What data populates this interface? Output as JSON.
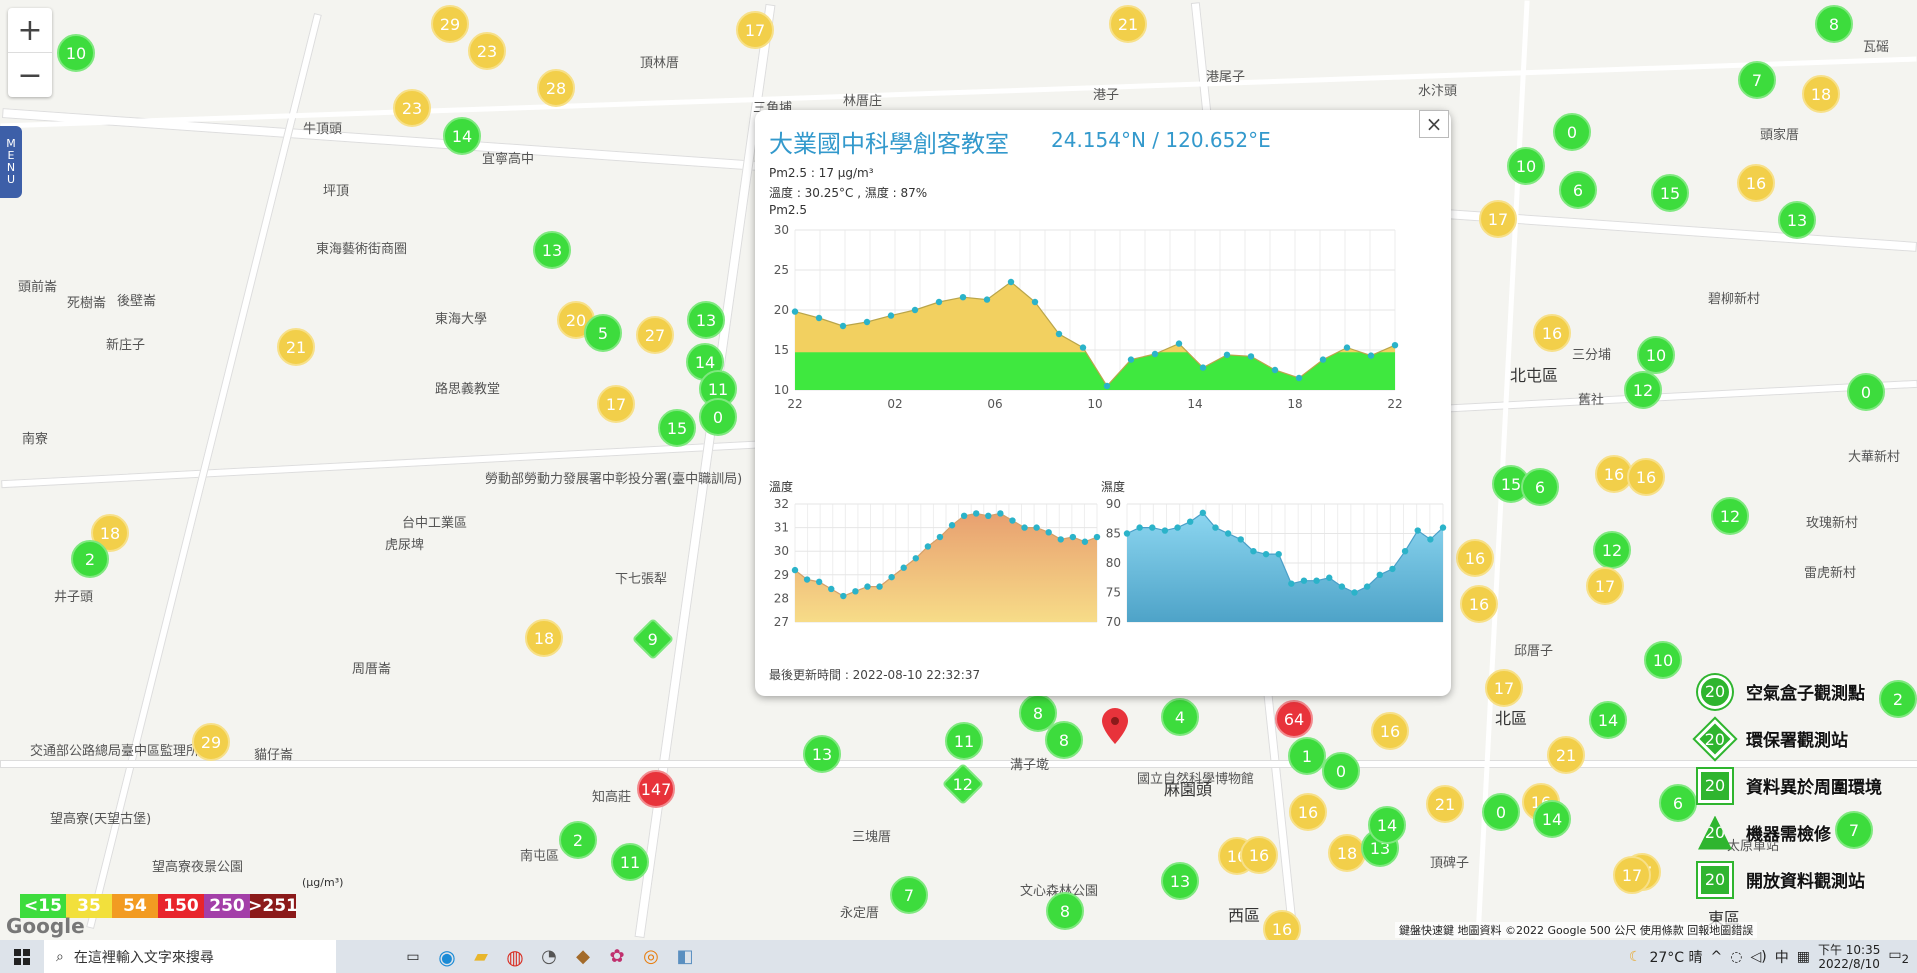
{
  "map": {
    "labels": [
      "頂林厝",
      "林厝庄",
      "三角埔",
      "港子",
      "港尾子",
      "水汴頭",
      "頭家厝",
      "瓦磘",
      "牛頂頭",
      "坪頂",
      "宜寧高中",
      "東海藝術街商圈",
      "頭前崙",
      "死樹崙",
      "後壁崙",
      "新庄子",
      "東海大學",
      "路思義教堂",
      "南寮",
      "井子頭",
      "台中工業區",
      "虎尿埤",
      "下七張犁",
      "周厝崙",
      "交通部公路總局臺中區監理所",
      "貓仔崙",
      "知高莊",
      "南屯區",
      "望高寮夜景公園",
      "望高寮(天望古堡)",
      "北屯區",
      "三分埔",
      "舊社",
      "碧柳新村",
      "大華新村",
      "玫瑰新村",
      "雷虎新村",
      "邱厝子",
      "北區",
      "東區",
      "西區",
      "麻園頭",
      "溝子墘",
      "三塊厝",
      "永定厝",
      "頂碑子",
      "勞動部勞動力發展署中彰投分署(臺中職訓局)",
      "國立自然科學博物館",
      "文心森林公園",
      "太原車站"
    ],
    "markers": [
      {
        "v": "10",
        "c": "green"
      },
      {
        "v": "29",
        "c": "yellow"
      },
      {
        "v": "23",
        "c": "yellow"
      },
      {
        "v": "17",
        "c": "yellow"
      },
      {
        "v": "21",
        "c": "yellow"
      },
      {
        "v": "8",
        "c": "green"
      },
      {
        "v": "7",
        "c": "green"
      },
      {
        "v": "18",
        "c": "yellow"
      },
      {
        "v": "23",
        "c": "yellow"
      },
      {
        "v": "28",
        "c": "yellow"
      },
      {
        "v": "14",
        "c": "green"
      },
      {
        "v": "0",
        "c": "green"
      },
      {
        "v": "10",
        "c": "green"
      },
      {
        "v": "6",
        "c": "green"
      },
      {
        "v": "15",
        "c": "green"
      },
      {
        "v": "16",
        "c": "yellow"
      },
      {
        "v": "17",
        "c": "yellow"
      },
      {
        "v": "13",
        "c": "green"
      },
      {
        "v": "13",
        "c": "green"
      },
      {
        "v": "20",
        "c": "yellow"
      },
      {
        "v": "5",
        "c": "green"
      },
      {
        "v": "27",
        "c": "yellow"
      },
      {
        "v": "13",
        "c": "green"
      },
      {
        "v": "14",
        "c": "green"
      },
      {
        "v": "11",
        "c": "green"
      },
      {
        "v": "0",
        "c": "green"
      },
      {
        "v": "15",
        "c": "green"
      },
      {
        "v": "17",
        "c": "yellow"
      },
      {
        "v": "21",
        "c": "yellow"
      },
      {
        "v": "16",
        "c": "yellow"
      },
      {
        "v": "10",
        "c": "green"
      },
      {
        "v": "12",
        "c": "green"
      },
      {
        "v": "0",
        "c": "green"
      },
      {
        "v": "15",
        "c": "green"
      },
      {
        "v": "18",
        "c": "yellow"
      },
      {
        "v": "2",
        "c": "green"
      },
      {
        "v": "16",
        "c": "yellow"
      },
      {
        "v": "16",
        "c": "yellow"
      },
      {
        "v": "6",
        "c": "green"
      },
      {
        "v": "12",
        "c": "green"
      },
      {
        "v": "12",
        "c": "green"
      },
      {
        "v": "17",
        "c": "yellow"
      },
      {
        "v": "16",
        "c": "yellow"
      },
      {
        "v": "16",
        "c": "yellow"
      },
      {
        "v": "18",
        "c": "yellow"
      },
      {
        "v": "29",
        "c": "yellow"
      },
      {
        "v": "147",
        "c": "red"
      },
      {
        "v": "2",
        "c": "green"
      },
      {
        "v": "11",
        "c": "green"
      },
      {
        "v": "13",
        "c": "green"
      },
      {
        "v": "11",
        "c": "green"
      },
      {
        "v": "8",
        "c": "green"
      },
      {
        "v": "8",
        "c": "green"
      },
      {
        "v": "4",
        "c": "green"
      },
      {
        "v": "64",
        "c": "red"
      },
      {
        "v": "1",
        "c": "green"
      },
      {
        "v": "0",
        "c": "green"
      },
      {
        "v": "16",
        "c": "yellow"
      },
      {
        "v": "16",
        "c": "yellow"
      },
      {
        "v": "17",
        "c": "yellow"
      },
      {
        "v": "14",
        "c": "green"
      },
      {
        "v": "21",
        "c": "yellow"
      },
      {
        "v": "21",
        "c": "yellow"
      },
      {
        "v": "0",
        "c": "green"
      },
      {
        "v": "16",
        "c": "yellow"
      },
      {
        "v": "14",
        "c": "green"
      },
      {
        "v": "6",
        "c": "green"
      },
      {
        "v": "17",
        "c": "yellow"
      },
      {
        "v": "10",
        "c": "green"
      },
      {
        "v": "7",
        "c": "green"
      },
      {
        "v": "7",
        "c": "green"
      },
      {
        "v": "8",
        "c": "green"
      },
      {
        "v": "13",
        "c": "green"
      },
      {
        "v": "16",
        "c": "yellow"
      },
      {
        "v": "16",
        "c": "yellow"
      },
      {
        "v": "18",
        "c": "yellow"
      },
      {
        "v": "13",
        "c": "green"
      },
      {
        "v": "16",
        "c": "yellow"
      },
      {
        "v": "14",
        "c": "green"
      },
      {
        "v": "2",
        "c": "green"
      },
      {
        "v": "17",
        "c": "yellow"
      }
    ],
    "diamonds": [
      {
        "v": "9"
      },
      {
        "v": "12"
      }
    ],
    "zoom_in": "+",
    "zoom_out": "−",
    "menu": [
      "M",
      "E",
      "N",
      "U"
    ],
    "google": "Google",
    "copyright": "鍵盤快速鍵   地圖資料 ©2022 Google   500 公尺   使用條款   回報地圖錯誤"
  },
  "popup": {
    "title": "大業國中科學創客教室",
    "coord": "24.154°N / 120.652°E",
    "pm25": "Pm2.5 : 17 μg/m³",
    "temp_hum": "溫度 : 30.25°C , 濕度 : 87%",
    "updated": "最後更新時間 : 2022-08-10 22:32:37",
    "close": "×"
  },
  "chart_data": [
    {
      "type": "area",
      "title": "Pm2.5",
      "x_ticks": [
        "22",
        "02",
        "06",
        "10",
        "14",
        "18",
        "22"
      ],
      "ylim": [
        10,
        30
      ],
      "y_ticks": [
        10,
        15,
        20,
        25,
        30
      ],
      "values": [
        19.8,
        19,
        18,
        18.5,
        19.3,
        20,
        21,
        21.6,
        21.3,
        23.5,
        21,
        17,
        15.3,
        10.5,
        13.8,
        14.5,
        15.8,
        12.8,
        14.4,
        14.2,
        12.5,
        11.5,
        13.8,
        15.3,
        14.3,
        15.6
      ]
    },
    {
      "type": "area",
      "title": "溫度",
      "ylim": [
        27,
        32
      ],
      "y_ticks": [
        27,
        28,
        29,
        30,
        31,
        32
      ],
      "values": [
        29.2,
        28.8,
        28.7,
        28.4,
        28.1,
        28.3,
        28.5,
        28.5,
        28.9,
        29.3,
        29.7,
        30.2,
        30.6,
        31.1,
        31.5,
        31.6,
        31.5,
        31.6,
        31.3,
        31,
        31,
        30.8,
        30.5,
        30.6,
        30.4,
        30.6
      ]
    },
    {
      "type": "area",
      "title": "濕度",
      "ylim": [
        70,
        90
      ],
      "y_ticks": [
        70,
        75,
        80,
        85,
        90
      ],
      "values": [
        85,
        86,
        86,
        85.5,
        86,
        87,
        88.5,
        86,
        85,
        84,
        82,
        81.5,
        81.5,
        76.5,
        77,
        77,
        77.5,
        76,
        75,
        76,
        78,
        79,
        82,
        85.5,
        84,
        86
      ]
    }
  ],
  "aqi_legend": {
    "unit": "(μg/m³)",
    "items": [
      {
        "label": "<15",
        "color": "#3ddc3d"
      },
      {
        "label": "35",
        "color": "#f2e03c"
      },
      {
        "label": "54",
        "color": "#f29b22"
      },
      {
        "label": "150",
        "color": "#e8252c"
      },
      {
        "label": "250",
        "color": "#a33fa8"
      },
      {
        "label": ">251",
        "color": "#8b1a1a"
      }
    ]
  },
  "station_legend": [
    {
      "label": "空氣盒子觀測點",
      "sym": "20"
    },
    {
      "label": "環保署觀測站",
      "sym": "20"
    },
    {
      "label": "資料異於周圍環境",
      "sym": "20"
    },
    {
      "label": "機器需檢修",
      "sym": "20"
    },
    {
      "label": "開放資料觀測站",
      "sym": "20"
    }
  ],
  "taskbar": {
    "search_placeholder": "在這裡輸入文字來搜尋",
    "weather": "27°C 晴",
    "ime": "中",
    "time": "下午 10:35",
    "date": "2022/8/10",
    "notif": "2"
  }
}
